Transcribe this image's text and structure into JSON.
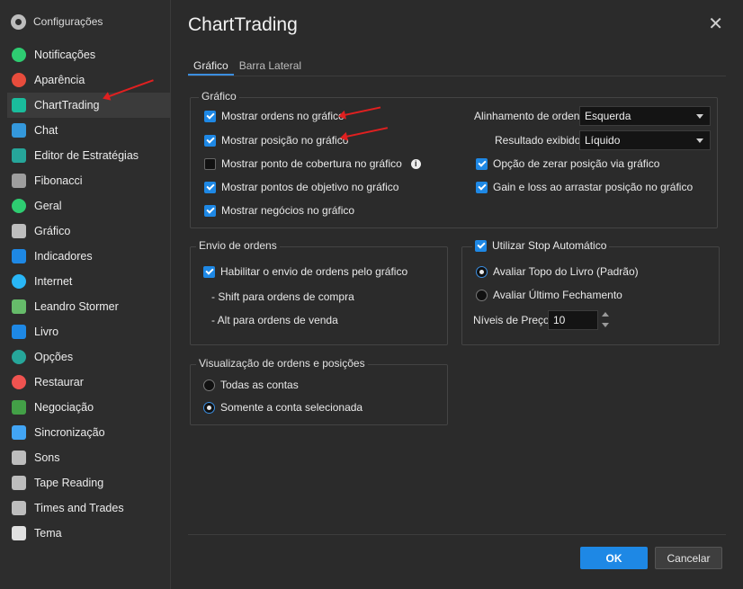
{
  "sidebar": {
    "header": "Configurações",
    "items": [
      {
        "label": "Notificações",
        "icon": "alarm-clock-icon",
        "color": "#2ecc71"
      },
      {
        "label": "Aparência",
        "icon": "palette-icon",
        "color": "#e74c3c"
      },
      {
        "label": "ChartTrading",
        "icon": "chart-trading-icon",
        "color": "#1abc9c"
      },
      {
        "label": "Chat",
        "icon": "chat-icon",
        "color": "#3498db"
      },
      {
        "label": "Editor de Estratégias",
        "icon": "play-icon",
        "color": "#26a69a"
      },
      {
        "label": "Fibonacci",
        "icon": "calculator-icon",
        "color": "#9e9e9e"
      },
      {
        "label": "Geral",
        "icon": "check-circle-icon",
        "color": "#2ecc71"
      },
      {
        "label": "Gráfico",
        "icon": "line-chart-icon",
        "color": "#bdbdbd"
      },
      {
        "label": "Indicadores",
        "icon": "indicator-icon",
        "color": "#1e88e5"
      },
      {
        "label": "Internet",
        "icon": "globe-icon",
        "color": "#29b6f6"
      },
      {
        "label": "Leandro Stormer",
        "icon": "book-icon",
        "color": "#66bb6a"
      },
      {
        "label": "Livro",
        "icon": "order-book-icon",
        "color": "#1e88e5"
      },
      {
        "label": "Opções",
        "icon": "options-icon",
        "color": "#26a69a"
      },
      {
        "label": "Restaurar",
        "icon": "restore-icon",
        "color": "#ef5350"
      },
      {
        "label": "Negociação",
        "icon": "trade-icon",
        "color": "#43a047"
      },
      {
        "label": "Sincronização",
        "icon": "cloud-icon",
        "color": "#42a5f5"
      },
      {
        "label": "Sons",
        "icon": "speaker-icon",
        "color": "#bdbdbd"
      },
      {
        "label": "Tape Reading",
        "icon": "tape-icon",
        "color": "#bdbdbd"
      },
      {
        "label": "Times and Trades",
        "icon": "times-trades-icon",
        "color": "#bdbdbd"
      },
      {
        "label": "Tema",
        "icon": "monitor-icon",
        "color": "#e0e0e0"
      }
    ],
    "active_index": 2
  },
  "main": {
    "title": "ChartTrading",
    "tabs": [
      "Gráfico",
      "Barra Lateral"
    ],
    "active_tab": 0,
    "grafico_group": {
      "label": "Gráfico",
      "checks": [
        {
          "label": "Mostrar ordens no gráfico",
          "checked": true
        },
        {
          "label": "Mostrar posição no gráfico",
          "checked": true
        },
        {
          "label": "Mostrar ponto de cobertura no gráfico",
          "checked": false
        },
        {
          "label": "Mostrar pontos de objetivo no gráfico",
          "checked": true
        },
        {
          "label": "Mostrar negócios no gráfico",
          "checked": true
        }
      ],
      "alinhamento_label": "Alinhamento de ordens",
      "alinhamento_value": "Esquerda",
      "resultado_label": "Resultado exibido",
      "resultado_value": "Líquido",
      "zerar_label": "Opção de zerar posição via gráfico",
      "gain_label": "Gain e loss ao arrastar posição no gráfico"
    },
    "envio_group": {
      "label": "Envio de ordens",
      "habilitar_label": "Habilitar o envio de ordens pelo gráfico",
      "shift_text": "- Shift para ordens de compra",
      "alt_text": "- Alt para ordens de venda"
    },
    "stop_group": {
      "label": "Utilizar Stop Automático",
      "topo_label": "Avaliar Topo do Livro (Padrão)",
      "ultimo_label": "Avaliar Último Fechamento",
      "niveis_label": "Níveis de Preço:",
      "niveis_value": "10"
    },
    "visual_group": {
      "label": "Visualização de ordens e posições",
      "todas_label": "Todas as contas",
      "somente_label": "Somente a conta selecionada"
    },
    "buttons": {
      "ok": "OK",
      "cancel": "Cancelar"
    },
    "close_glyph": "✕",
    "info_glyph": "i"
  }
}
